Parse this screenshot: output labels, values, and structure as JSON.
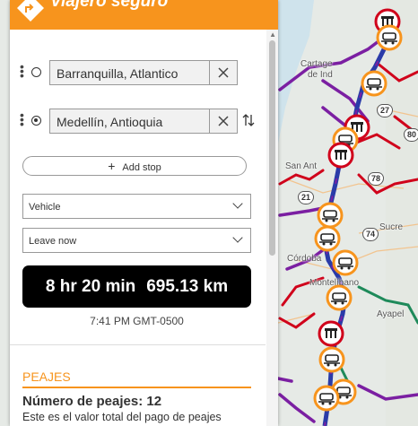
{
  "header": {
    "app_title": "Viajero seguro",
    "brand_color": "#f7941d"
  },
  "route": {
    "origin": "Barranquilla, Atlantico",
    "destination": "Medellín, Antioquia",
    "add_stop_label": "Add stop",
    "vehicle_select": "Vehicle",
    "departure_select": "Leave now"
  },
  "summary": {
    "duration": "8 hr 20 min",
    "distance": "695.13 km",
    "arrival_time": "7:41 PM GMT-0500"
  },
  "peajes": {
    "title": "PEAJES",
    "count_label": "Número de peajes: 12",
    "description": "Este es el valor total del pago de peajes"
  },
  "map": {
    "labels": [
      "Cartage",
      "de Ind",
      "San Ant",
      "Sucre",
      "Córdoba",
      "Montelíbano",
      "Ayapel"
    ],
    "shields": [
      "27",
      "80",
      "78",
      "21",
      "74"
    ],
    "marker_icon": "toll-booth-icon",
    "route_color": "#2a3ba8",
    "traffic_colors": {
      "heavy": "#d0021b",
      "moderate": "#7b1fa2",
      "light": "#1e8a5a"
    }
  }
}
